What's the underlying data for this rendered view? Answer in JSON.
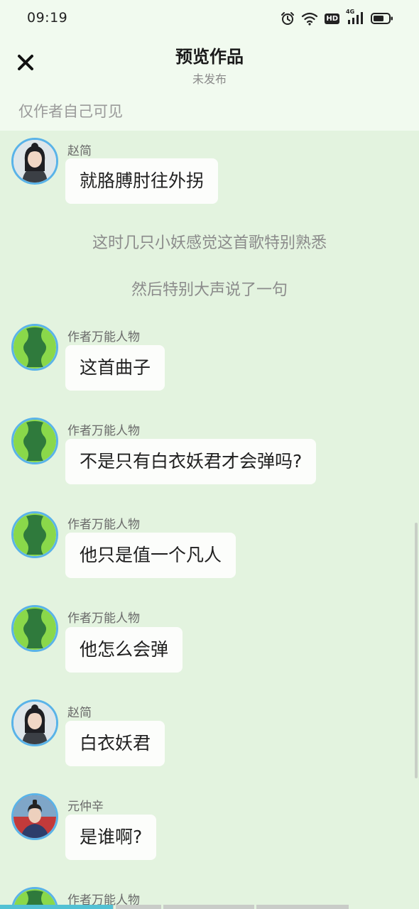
{
  "status_bar": {
    "time": "09:19",
    "network_label": "4G",
    "hd_label": "HD",
    "battery_level": 0.7
  },
  "header": {
    "close_icon": "close-icon",
    "title": "预览作品",
    "subtitle": "未发布"
  },
  "visibility_note": "仅作者自己可见",
  "messages": [
    {
      "type": "chat",
      "sender": "赵简",
      "avatar": "portrait-woman",
      "text": "就胳膊肘往外拐"
    },
    {
      "type": "narration",
      "text": "这时几只小妖感觉这首歌特别熟悉"
    },
    {
      "type": "narration",
      "text": "然后特别大声说了一句"
    },
    {
      "type": "chat",
      "sender": "作者万能人物",
      "avatar": "green-silhouette",
      "text": "这首曲子"
    },
    {
      "type": "chat",
      "sender": "作者万能人物",
      "avatar": "green-silhouette",
      "text": "不是只有白衣妖君才会弹吗?"
    },
    {
      "type": "chat",
      "sender": "作者万能人物",
      "avatar": "green-silhouette",
      "text": "他只是值一个凡人"
    },
    {
      "type": "chat",
      "sender": "作者万能人物",
      "avatar": "green-silhouette",
      "text": "他怎么会弹"
    },
    {
      "type": "chat",
      "sender": "赵简",
      "avatar": "portrait-woman",
      "text": "白衣妖君"
    },
    {
      "type": "chat",
      "sender": "元仲辛",
      "avatar": "portrait-man",
      "text": "是谁啊?"
    },
    {
      "type": "chat",
      "sender": "作者万能人物",
      "avatar": "green-silhouette",
      "text": ""
    }
  ],
  "colors": {
    "background": "#e3f3df",
    "header_background": "#f1faef",
    "avatar_border": "#5ab3e8",
    "progress_fill": "#52c1d4"
  },
  "progress": {
    "segments": 4,
    "fraction": 0.27
  }
}
